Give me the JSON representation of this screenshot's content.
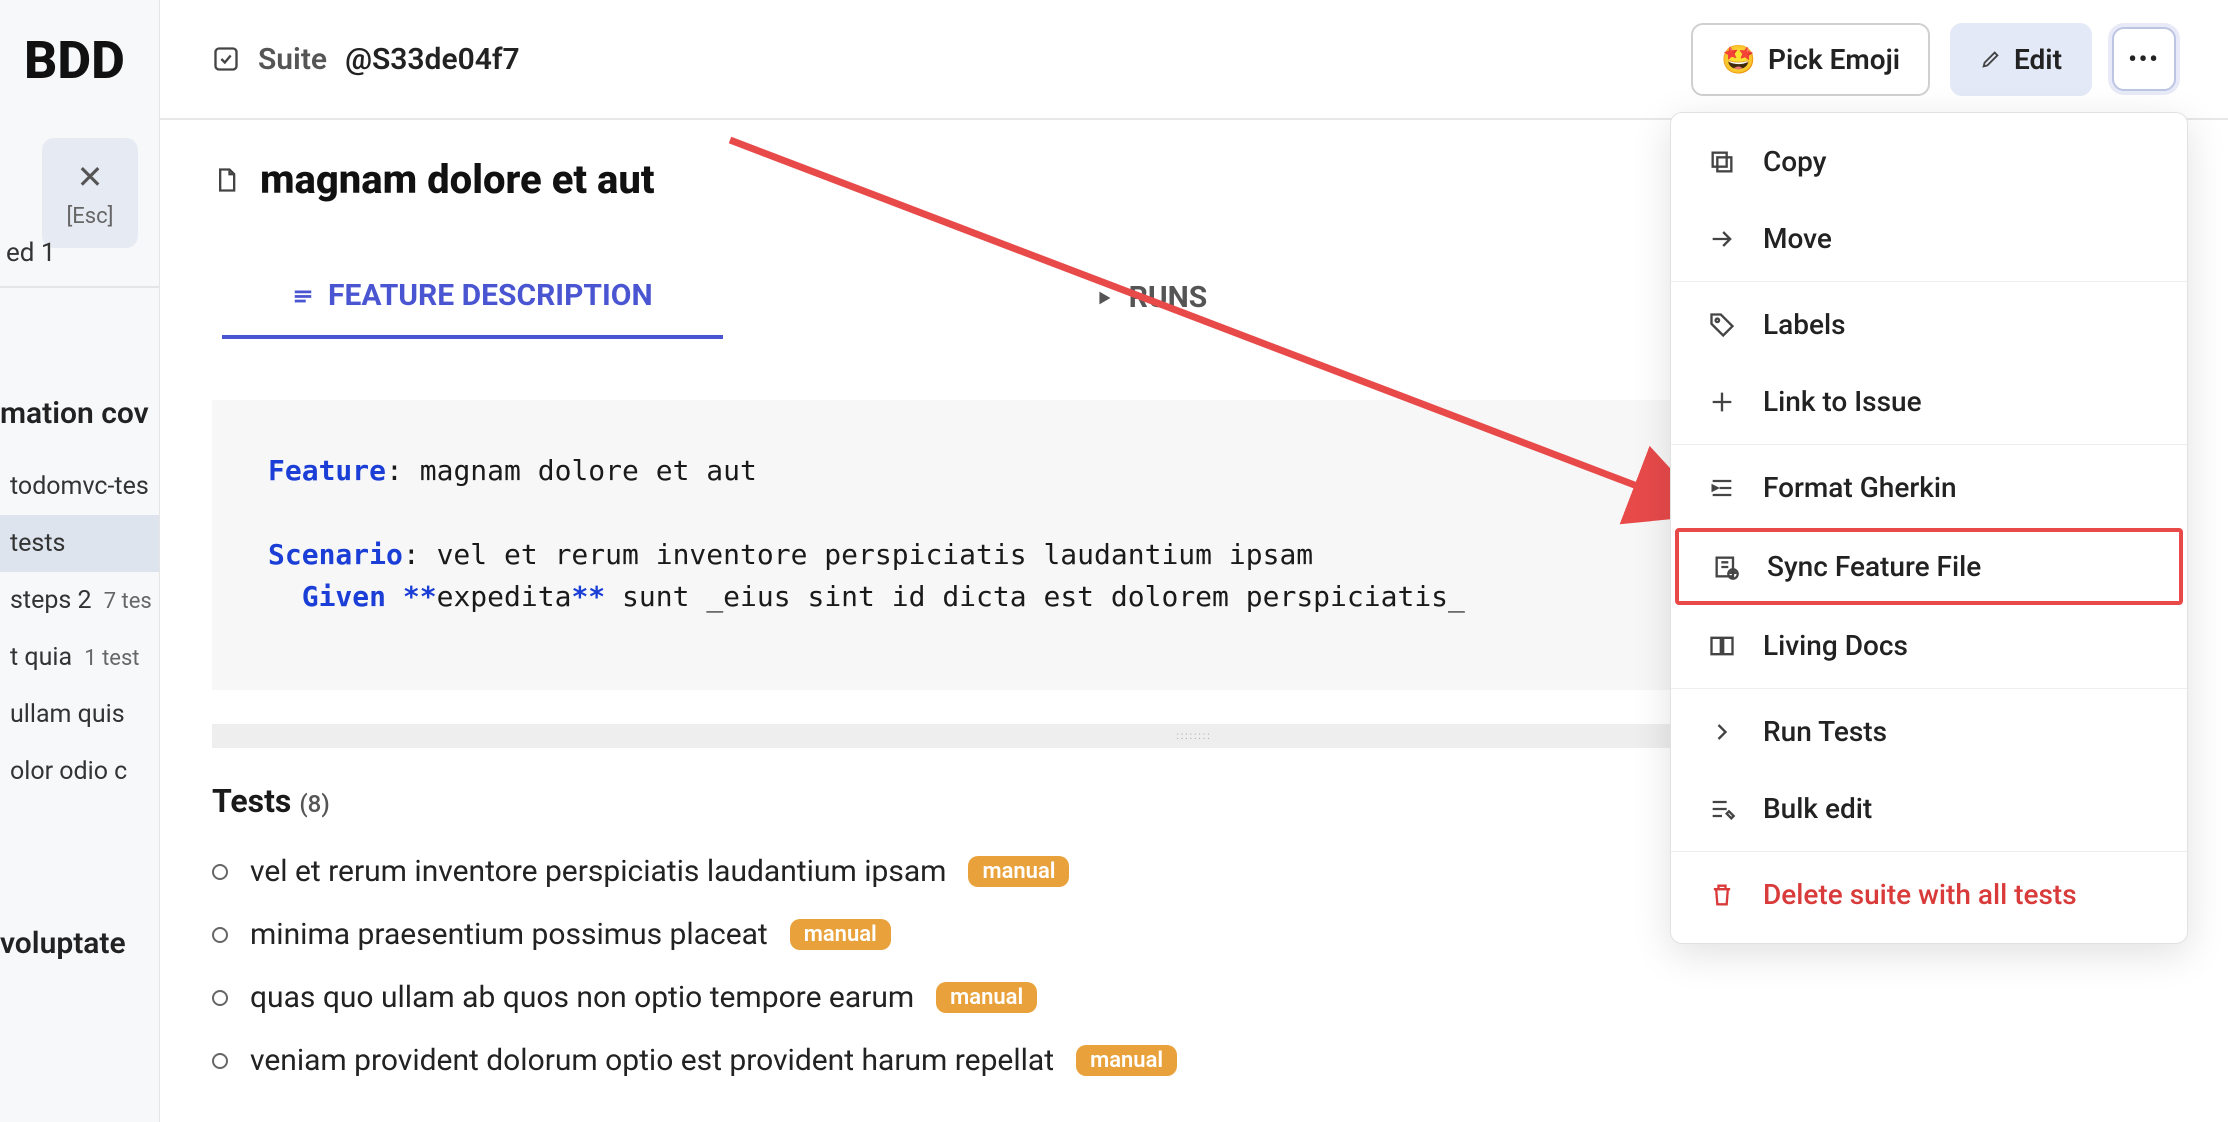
{
  "sidebar": {
    "brand": "BDD",
    "close_label": "[Esc]",
    "sub_label": "ed 1",
    "heading1": "mation cov",
    "items": [
      {
        "label": "todomvc-tes",
        "count": ""
      },
      {
        "label": "tests",
        "count": "",
        "selected": true
      },
      {
        "label": "steps 2",
        "count": "7 tes"
      },
      {
        "label": "t quia",
        "count": "1 test"
      },
      {
        "label": "ullam quis",
        "count": ""
      },
      {
        "label": "olor odio c",
        "count": ""
      }
    ],
    "heading2": "voluptate"
  },
  "topbar": {
    "breadcrumb_prefix": "Suite",
    "breadcrumb_id": "@S33de04f7",
    "emoji": "🤩",
    "pick_emoji": "Pick Emoji",
    "edit": "Edit"
  },
  "title": "magnam dolore et aut",
  "tabs": {
    "feature": "FEATURE DESCRIPTION",
    "runs": "RUNS"
  },
  "code": {
    "feature_kw": "Feature",
    "feature_val": ": magnam dolore et aut",
    "scenario_kw": "Scenario",
    "scenario_val": ": vel et rerum inventore perspiciatis laudantium ipsam",
    "given_kw": "Given",
    "given_ast1": "**",
    "given_mid": "expedita",
    "given_ast2": "**",
    "given_rest": " sunt _eius sint id dicta est dolorem perspiciatis_"
  },
  "tests": {
    "heading": "Tests",
    "count": "(8)",
    "items": [
      {
        "name": "vel et rerum inventore perspiciatis laudantium ipsam",
        "badge": "manual"
      },
      {
        "name": "minima praesentium possimus placeat",
        "badge": "manual"
      },
      {
        "name": "quas quo ullam ab quos non optio tempore earum",
        "badge": "manual"
      },
      {
        "name": "veniam provident dolorum optio est provident harum repellat",
        "badge": "manual"
      }
    ]
  },
  "dropdown": {
    "copy": "Copy",
    "move": "Move",
    "labels": "Labels",
    "link_issue": "Link to Issue",
    "format_gherkin": "Format Gherkin",
    "sync_feature": "Sync Feature File",
    "living_docs": "Living Docs",
    "run_tests": "Run Tests",
    "bulk_edit": "Bulk edit",
    "delete": "Delete suite with all tests"
  }
}
